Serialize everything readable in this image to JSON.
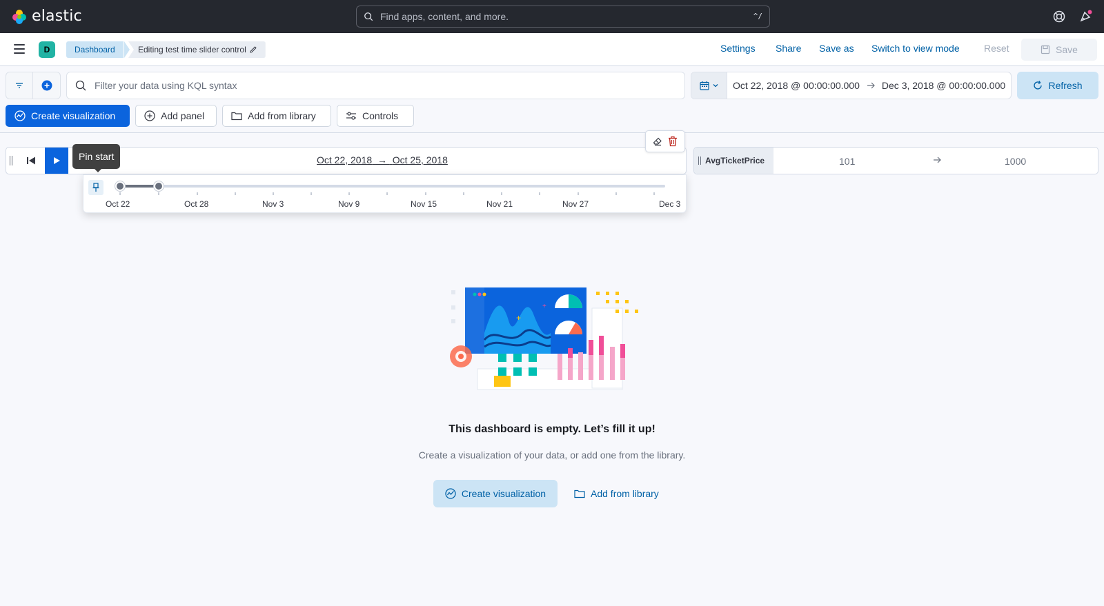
{
  "header": {
    "brand": "elastic",
    "search_placeholder": "Find apps, content, and more.",
    "search_shortcut": "^/"
  },
  "app_bar": {
    "space_initial": "D",
    "breadcrumbs": [
      "Dashboard",
      "Editing test time slider control"
    ],
    "actions": {
      "settings": "Settings",
      "share": "Share",
      "save_as": "Save as",
      "switch_view": "Switch to view mode",
      "reset": "Reset",
      "save": "Save"
    }
  },
  "query_bar": {
    "kql_placeholder": "Filter your data using KQL syntax",
    "date_start": "Oct 22, 2018 @ 00:00:00.000",
    "date_end": "Dec 3, 2018 @ 00:00:00.000",
    "refresh": "Refresh"
  },
  "toolbar": {
    "create_visualization": "Create visualization",
    "add_panel": "Add panel",
    "add_from_library": "Add from library",
    "controls": "Controls"
  },
  "time_slider": {
    "range_start": "Oct 22, 2018",
    "range_end": "Oct 25, 2018",
    "tooltip": "Pin start",
    "ticks": [
      "Oct 22",
      "Oct 28",
      "Nov 3",
      "Nov 9",
      "Nov 15",
      "Nov 21",
      "Nov 27",
      "Dec 3"
    ]
  },
  "range_control": {
    "label": "AvgTicketPrice",
    "min": "101",
    "max": "1000"
  },
  "empty_state": {
    "title": "This dashboard is empty. Let’s fill it up!",
    "subtitle": "Create a visualization of your data, or add one from the library.",
    "primary": "Create visualization",
    "secondary": "Add from library"
  },
  "colors": {
    "header_bg": "#25282f",
    "primary": "#0b64dd",
    "link": "#0061a6",
    "primary_light": "#cce4f5"
  }
}
